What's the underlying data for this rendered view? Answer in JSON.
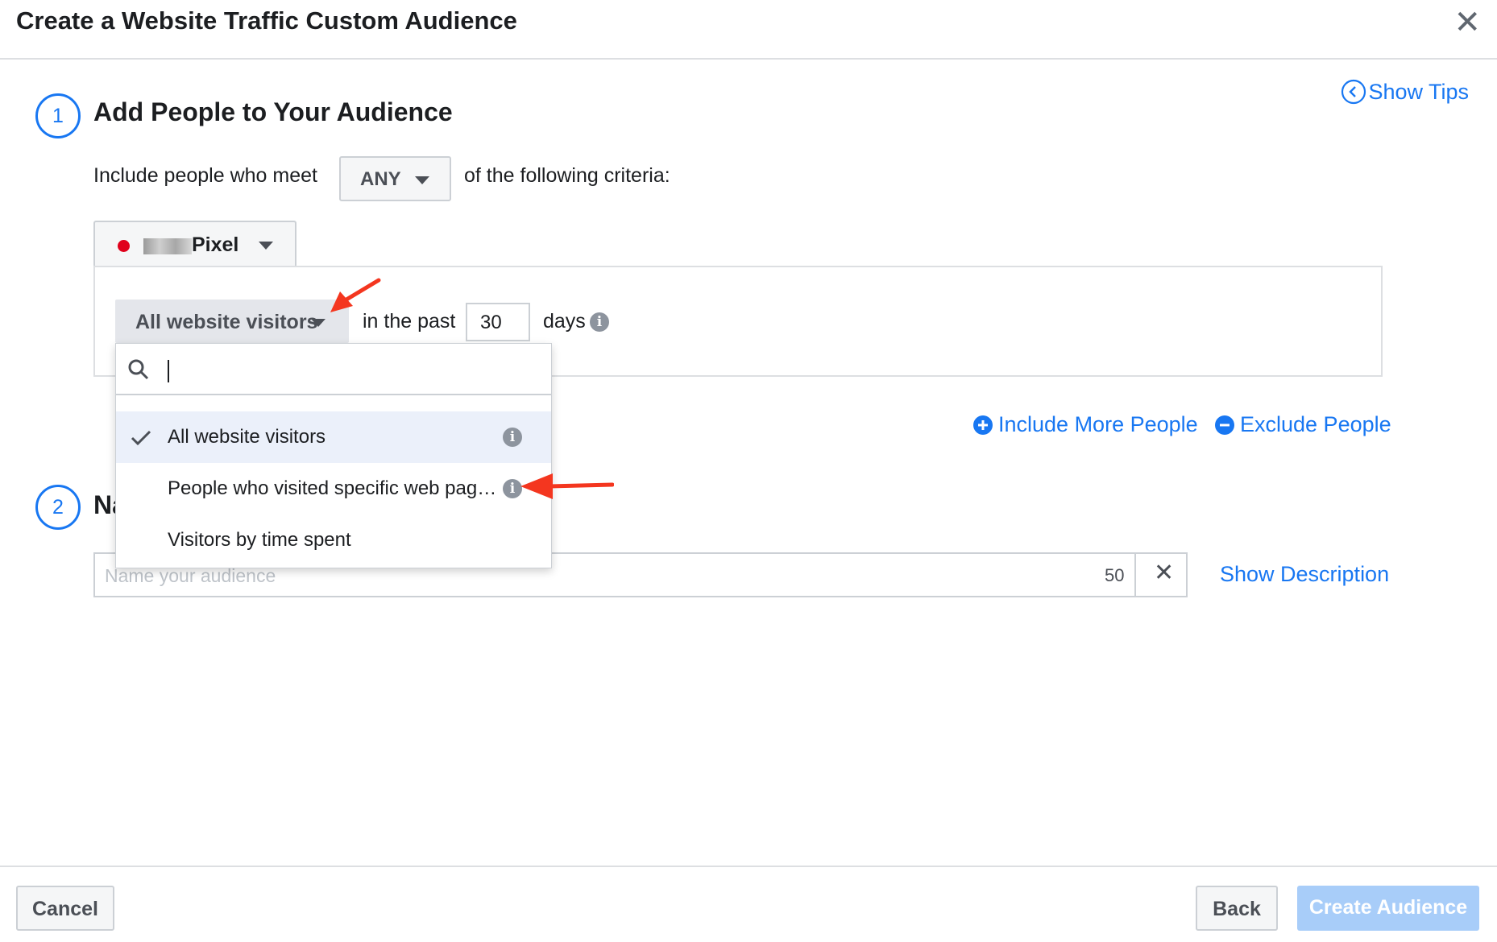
{
  "dialog": {
    "title": "Create a Website Traffic Custom Audience",
    "close_icon": "close-icon"
  },
  "tips": {
    "label": "Show Tips",
    "icon": "chevron-left-circle-icon"
  },
  "step1": {
    "number": "1",
    "title": "Add People to Your Audience",
    "include_prefix": "Include people who meet",
    "match_select": "ANY",
    "include_suffix": "of the following criteria:"
  },
  "pixel": {
    "label": "Pixel",
    "status_color": "#e0001b"
  },
  "rule": {
    "visitor_select": "All website visitors",
    "in_the_past": "in the past",
    "days_value": "30",
    "days_label": "days"
  },
  "dropdown_menu": {
    "search_placeholder": "",
    "items": [
      {
        "label": "All website visitors",
        "selected": true
      },
      {
        "label": "People who visited specific web pag…",
        "selected": false
      },
      {
        "label": "Visitors by time spent",
        "selected": false
      }
    ]
  },
  "actions": {
    "include_more": "Include More People",
    "exclude": "Exclude People"
  },
  "step2": {
    "number": "2",
    "title_visible": "Na",
    "name_placeholder": "Name your audience",
    "char_count": "50",
    "show_description": "Show Description"
  },
  "footer": {
    "cancel": "Cancel",
    "back": "Back",
    "create": "Create Audience"
  },
  "colors": {
    "accent": "#1877f2",
    "annotation_arrow": "#f4361f",
    "create_button_disabled": "#a8cdf9"
  }
}
